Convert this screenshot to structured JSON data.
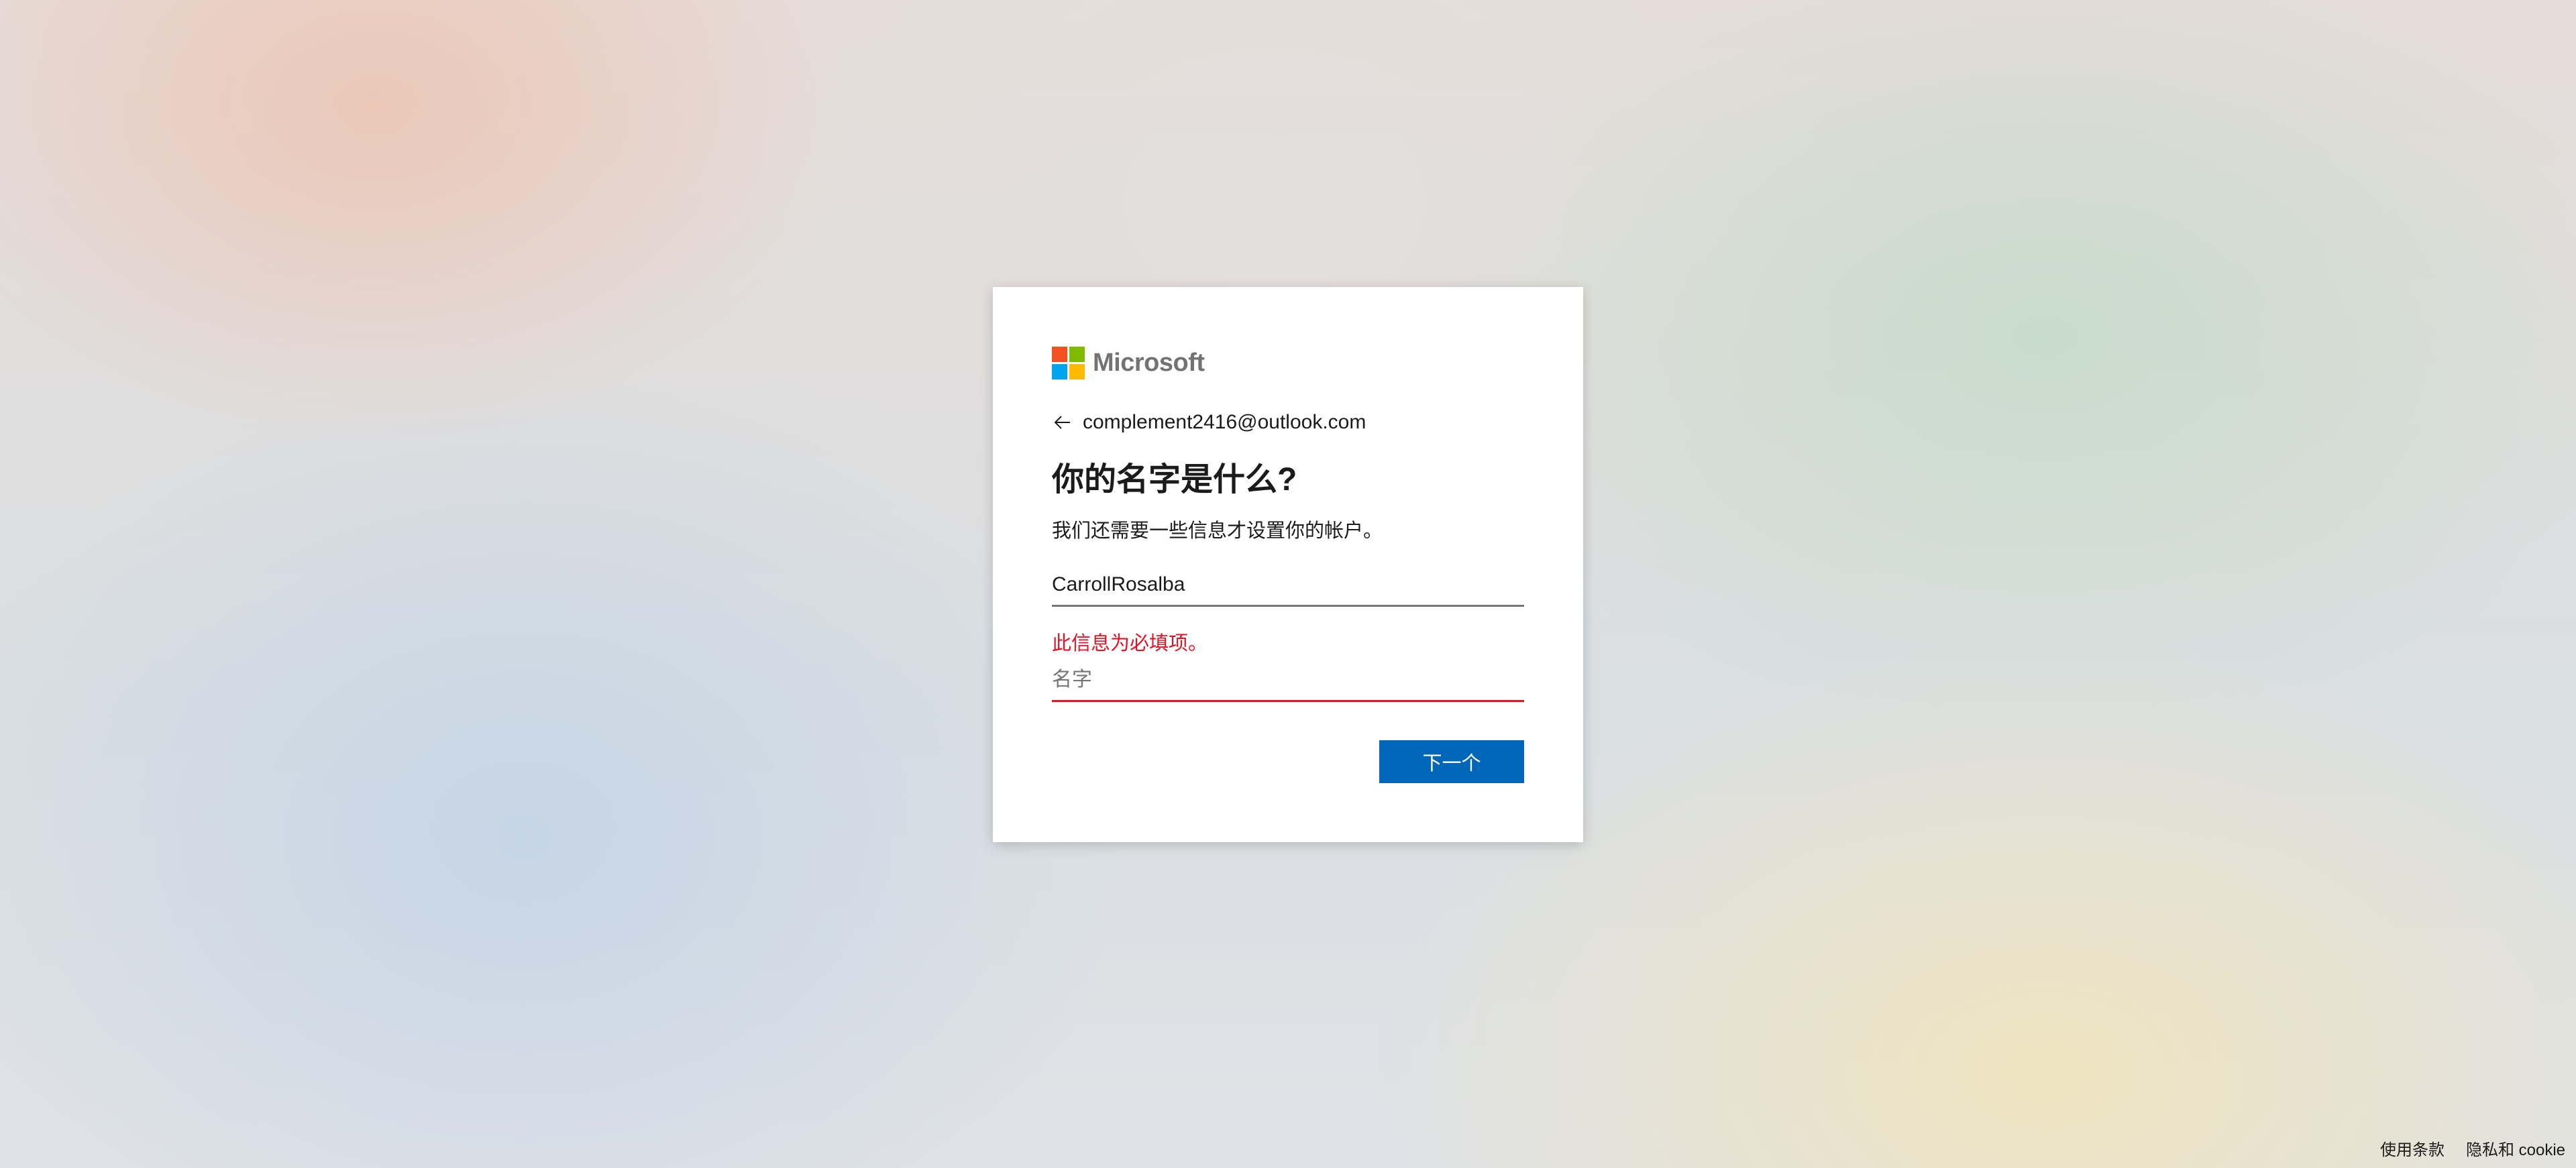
{
  "brand": {
    "name": "Microsoft",
    "logo_colors": [
      "#f25022",
      "#7fba00",
      "#00a4ef",
      "#ffb900"
    ]
  },
  "identity": {
    "back_icon": "arrow-left-icon",
    "email": "complement2416@outlook.com"
  },
  "form": {
    "title": "你的名字是什么?",
    "description": "我们还需要一些信息才设置你的帐户。",
    "surname": {
      "value": "CarrollRosalba",
      "placeholder": ""
    },
    "error_message": "此信息为必填项。",
    "first_name": {
      "value": "",
      "placeholder": "名字"
    },
    "next_label": "下一个"
  },
  "colors": {
    "accent": "#0067b8",
    "error": "#e81123"
  },
  "footer": {
    "terms": "使用条款",
    "privacy": "隐私和 cookie"
  }
}
